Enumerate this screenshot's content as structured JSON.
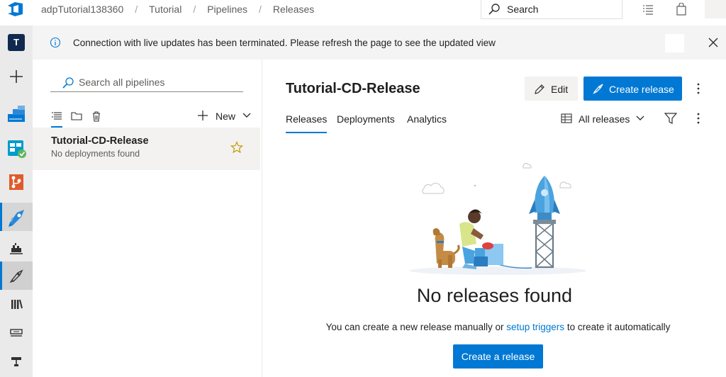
{
  "breadcrumb": {
    "items": [
      "adpTutorial138360",
      "Tutorial",
      "Pipelines",
      "Releases"
    ],
    "separator": "/"
  },
  "top_search": {
    "label": "Search"
  },
  "rail": {
    "project_initial": "T",
    "items": [
      "add",
      "overview",
      "boards",
      "repos",
      "pipelines",
      "builds",
      "releases",
      "library",
      "task-groups",
      "deployment-groups"
    ],
    "active": "releases"
  },
  "banner": {
    "message": "Connection with live updates has been terminated. Please refresh the page to see the updated view"
  },
  "pipelines_pane": {
    "search_placeholder": "Search all pipelines",
    "new_label": "New",
    "items": [
      {
        "name": "Tutorial-CD-Release",
        "status": "No deployments found",
        "favorite": false
      }
    ]
  },
  "main": {
    "title": "Tutorial-CD-Release",
    "edit_label": "Edit",
    "create_release_label": "Create release",
    "tabs": [
      "Releases",
      "Deployments",
      "Analytics"
    ],
    "active_tab": "Releases",
    "filter_label": "All releases",
    "empty_state": {
      "title": "No releases found",
      "desc_before": "You can create a new release manually or ",
      "desc_link": "setup triggers",
      "desc_after": " to create it automatically",
      "button_label": "Create a release"
    }
  },
  "colors": {
    "accent": "#0078d4",
    "banner_bg": "#f4f4f4",
    "rail_bg": "#eaeaea",
    "selected_row": "#f3f2f1",
    "star": "#c19c00"
  }
}
